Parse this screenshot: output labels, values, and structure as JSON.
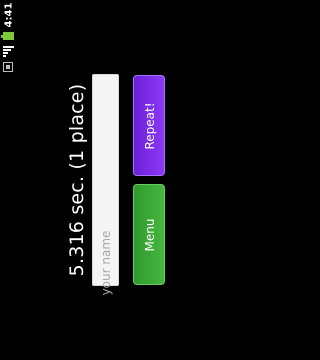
{
  "status_bar": {
    "time": "4:41",
    "icons": [
      "battery-icon",
      "signal-icon",
      "sdcard-icon"
    ]
  },
  "result": {
    "text": "5.316 sec. (1 place)"
  },
  "name_input": {
    "value": "",
    "placeholder": "your name"
  },
  "buttons": {
    "repeat_label": "Repeat!",
    "menu_label": "Menu"
  },
  "colors": {
    "background": "#000000",
    "repeat_button": "#7b2cf0",
    "menu_button": "#3aa835",
    "input_background": "#f4f4f4"
  }
}
